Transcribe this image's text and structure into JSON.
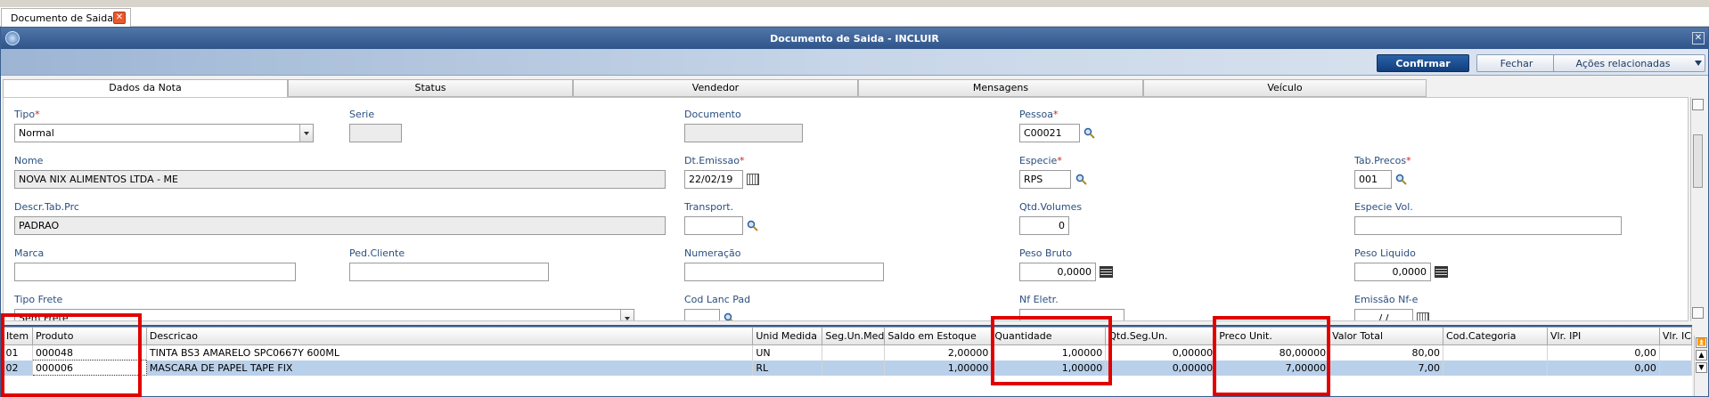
{
  "app": {
    "tab_title": "Documento de Saida",
    "window_title": "Documento de Saida - INCLUIR"
  },
  "toolbar": {
    "confirm_label": "Confirmar",
    "close_label": "Fechar",
    "actions_label": "Ações relacionadas"
  },
  "folders": [
    "Dados da Nota",
    "Status",
    "Vendedor",
    "Mensagens",
    "Veículo"
  ],
  "form": {
    "tipo": {
      "label": "Tipo",
      "value": "Normal"
    },
    "serie": {
      "label": "Serie",
      "value": ""
    },
    "documento": {
      "label": "Documento",
      "value": ""
    },
    "pessoa": {
      "label": "Pessoa",
      "value": "C00021"
    },
    "nome": {
      "label": "Nome",
      "value": "NOVA NIX ALIMENTOS LTDA - ME"
    },
    "dt_emissao": {
      "label": "Dt.Emissao",
      "value": "22/02/19"
    },
    "especie": {
      "label": "Especie",
      "value": "RPS"
    },
    "tab_precos": {
      "label": "Tab.Precos",
      "value": "001"
    },
    "descr_tab_prc": {
      "label": "Descr.Tab.Prc",
      "value": "PADRAO"
    },
    "transport": {
      "label": "Transport.",
      "value": ""
    },
    "qtd_volumes": {
      "label": "Qtd.Volumes",
      "value": "0"
    },
    "especie_vol": {
      "label": "Especie Vol.",
      "value": ""
    },
    "marca": {
      "label": "Marca",
      "value": ""
    },
    "ped_cliente": {
      "label": "Ped.Cliente",
      "value": ""
    },
    "numeracao": {
      "label": "Numeração",
      "value": ""
    },
    "peso_bruto": {
      "label": "Peso Bruto",
      "value": "0,0000"
    },
    "peso_liquido": {
      "label": "Peso Liquido",
      "value": "0,0000"
    },
    "tipo_frete": {
      "label": "Tipo Frete",
      "value": "Sem Frete"
    },
    "cod_lanc_pad": {
      "label": "Cod Lanc Pad",
      "value": ""
    },
    "nf_eletr": {
      "label": "Nf Eletr.",
      "value": ""
    },
    "emissao_nfe": {
      "label": "Emissão Nf-e",
      "value": " / / "
    }
  },
  "grid": {
    "columns": [
      "Item",
      "Produto",
      "Descricao",
      "Unid Medida",
      "Seg.Un.Med",
      "Saldo em Estoque",
      "Quantidade",
      "Qtd.Seg.Un.",
      "Preco Unit.",
      "Valor Total",
      "Cod.Categoria",
      "Vlr. IPI",
      "Vlr. IC"
    ],
    "rows": [
      [
        "01",
        "000048",
        "TINTA BS3 AMARELO SPC0667Y 600ML",
        "UN",
        "",
        "2,00000",
        "1,00000",
        "0,00000",
        "80,00000",
        "80,00",
        "",
        "0,00",
        ""
      ],
      [
        "02",
        "000006",
        "MASCARA DE PAPEL TAPE FIX",
        "RL",
        "",
        "1,00000",
        "1,00000",
        "0,00000",
        "7,00000",
        "7,00",
        "",
        "0,00",
        ""
      ]
    ]
  },
  "colors": {
    "title_bar": "#2e548a",
    "confirm_button": "#1c4f92",
    "label_text": "#2a4f7f",
    "required_mark": "#d61d1d",
    "selected_row": "#b9d0ea",
    "highlight_box": "#e10000"
  }
}
